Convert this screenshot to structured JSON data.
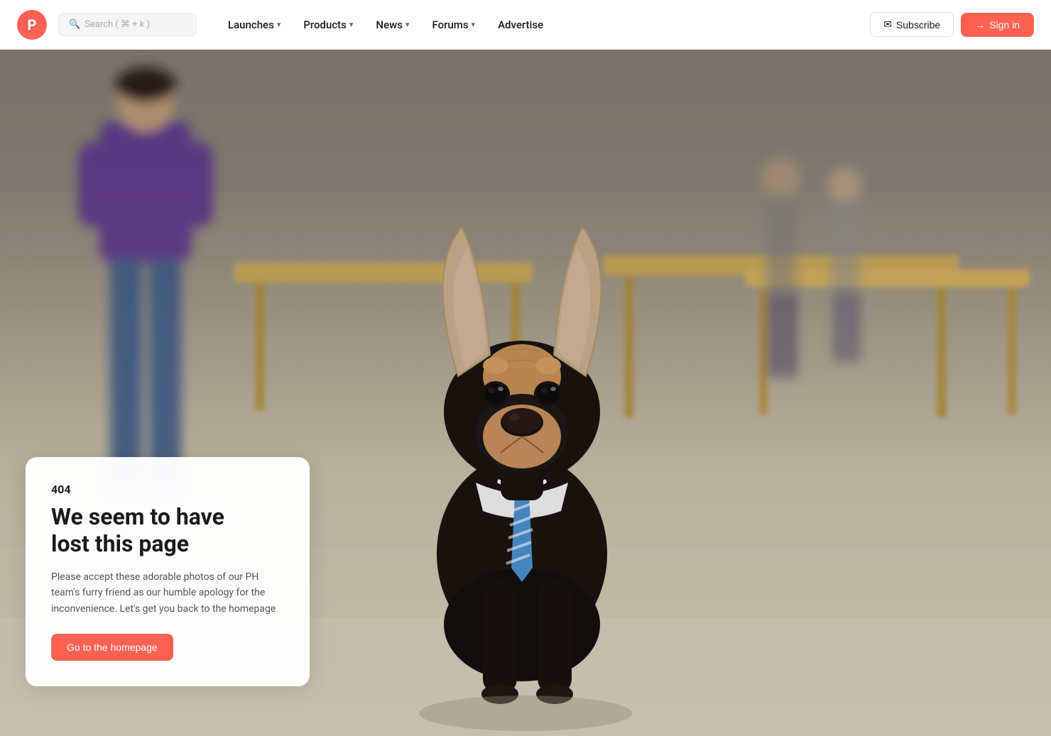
{
  "nav": {
    "logo_letter": "P",
    "search_placeholder": "Search ( ⌘ + k )",
    "links": [
      {
        "label": "Launches",
        "has_chevron": true
      },
      {
        "label": "Products",
        "has_chevron": true
      },
      {
        "label": "News",
        "has_chevron": true
      },
      {
        "label": "Forums",
        "has_chevron": true
      },
      {
        "label": "Advertise",
        "has_chevron": false
      }
    ],
    "subscribe_label": "Subscribe",
    "signin_label": "Sign in"
  },
  "error": {
    "code": "404",
    "title_line1": "We seem to have",
    "title_line2": "lost this page",
    "description": "Please accept these adorable photos of our PH team's furry friend as our humble apology for the inconvenience. Let's get you back to the homepage",
    "cta_label": "Go to the homepage"
  },
  "colors": {
    "brand": "#ff6154",
    "text_dark": "#1a1a1a",
    "text_muted": "#555555"
  }
}
